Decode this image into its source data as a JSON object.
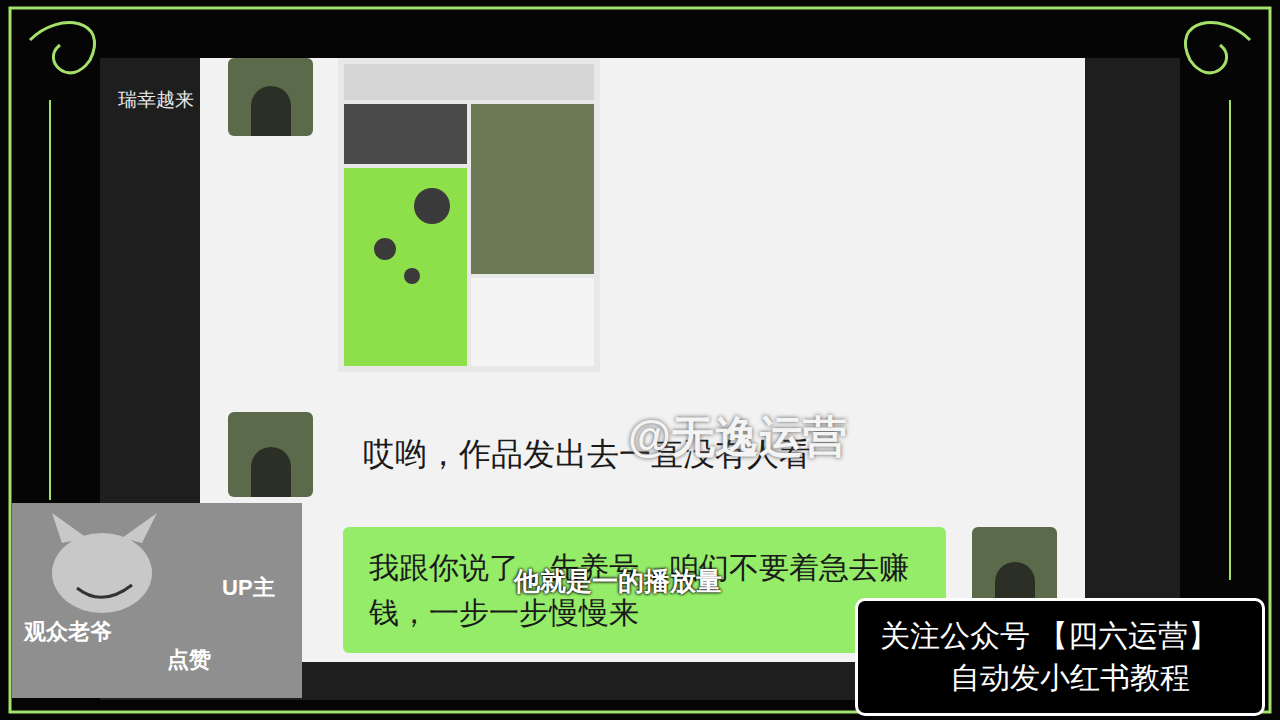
{
  "video_title": "瑞幸越来",
  "logo": "bili",
  "chat": {
    "messages": [
      {
        "side": "left",
        "kind": "image"
      },
      {
        "side": "left",
        "kind": "text",
        "text": "哎哟，作品发出去一直没有人看"
      },
      {
        "side": "right",
        "kind": "text",
        "text": "我跟你说了，先养号，咱们不要着急去赚钱，一步一步慢慢来"
      }
    ]
  },
  "watermark": "@无逸运营",
  "subtitle": "他就是一的播放量",
  "sticker": {
    "labels": [
      "UP主",
      "观众老爷",
      "点赞"
    ]
  },
  "banner": {
    "lines": [
      "关注公众号 【四六运营】",
      "自动发小红书教程"
    ]
  }
}
